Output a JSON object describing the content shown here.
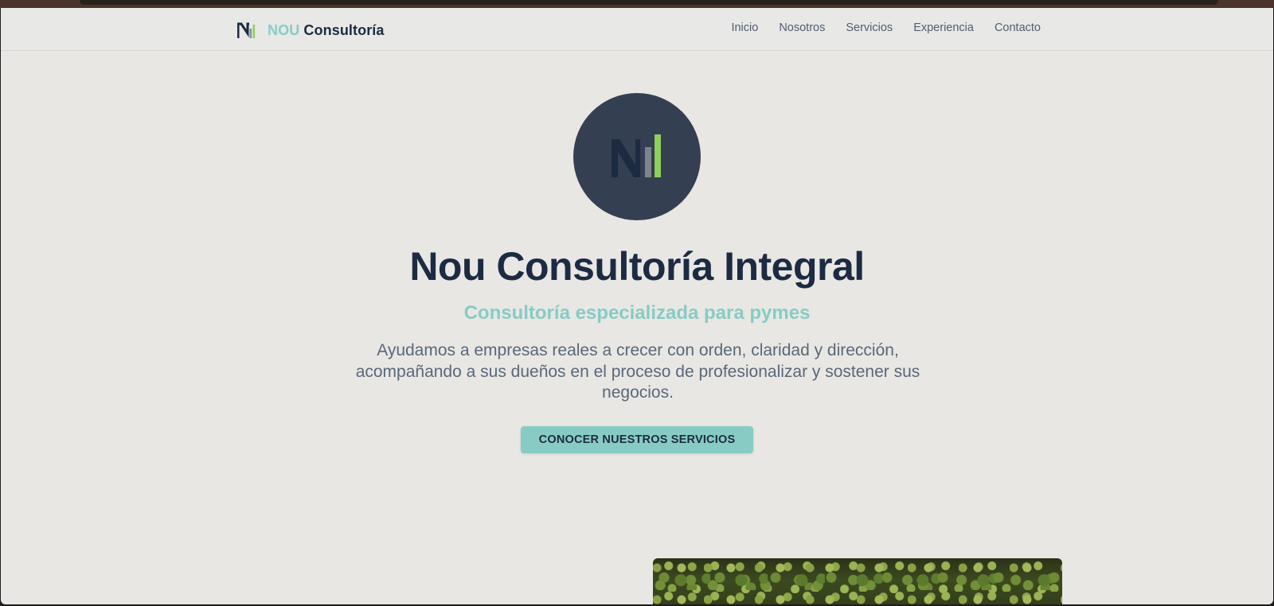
{
  "brand": {
    "icon": "nou-logo-icon",
    "name_highlight": "NOU",
    "name_rest": "Consultoría"
  },
  "nav": {
    "links": [
      "Inicio",
      "Nosotros",
      "Servicios",
      "Experiencia",
      "Contacto"
    ]
  },
  "hero": {
    "logo_icon": "nou-logo-icon",
    "title": "Nou Consultoría Integral",
    "subtitle": "Consultoría especializada para pymes",
    "description": "Ayudamos a empresas reales a crecer con orden, claridad y dirección, acompañando a sus dueños en el proceso de profesionalizar y sostener sus negocios.",
    "cta_label": "CONOCER NUESTROS SERVICIOS"
  },
  "colors": {
    "navy": "#1c2b42",
    "teal": "#88cbc5",
    "lime": "#8fcf5a",
    "slate_circle": "#343f51",
    "background": "#e8e7e4"
  }
}
